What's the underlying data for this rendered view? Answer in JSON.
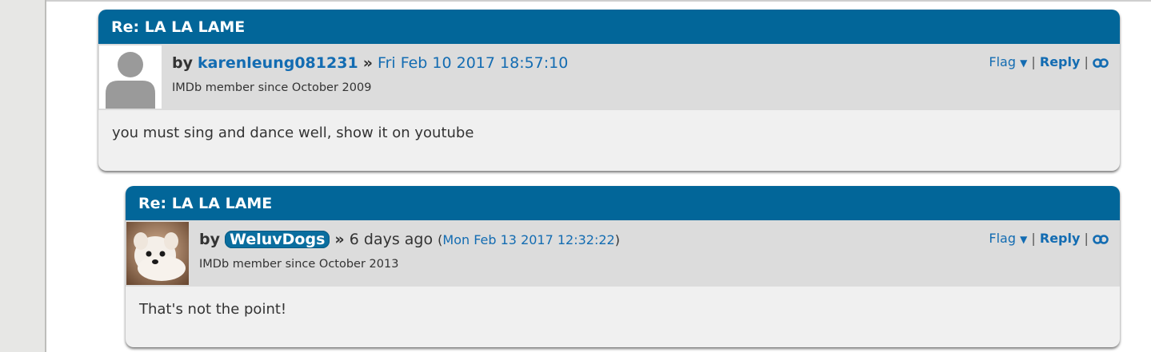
{
  "posts": [
    {
      "title": "Re: LA LA LAME",
      "by": "by",
      "username": "karenleung081231",
      "separator": "»",
      "date": "Fri Feb 10 2017 18:57:10",
      "member_since": "IMDb member since October 2009",
      "flag": "Flag",
      "flag_arrow": "▼",
      "pipe": "|",
      "reply": "Reply",
      "avatar_icon": "default-user-silhouette-icon",
      "body": "you must sing and dance well, show it on youtube"
    },
    {
      "title": "Re: LA LA LAME",
      "by": "by",
      "username": "WeluvDogs",
      "separator": "»",
      "relative_time": "6 days ago",
      "open_paren": "(",
      "date": "Mon Feb 13 2017 12:32:22",
      "close_paren": ")",
      "member_since": "IMDb member since October 2013",
      "flag": "Flag",
      "flag_arrow": "▼",
      "pipe": "|",
      "reply": "Reply",
      "avatar_icon": "dog-photo-avatar",
      "body": "That's not the point!"
    }
  ],
  "colors": {
    "header_bg": "#026699",
    "link": "#136cb2",
    "meta_bg": "#dcdcdc",
    "body_bg": "#f0f0f0"
  }
}
